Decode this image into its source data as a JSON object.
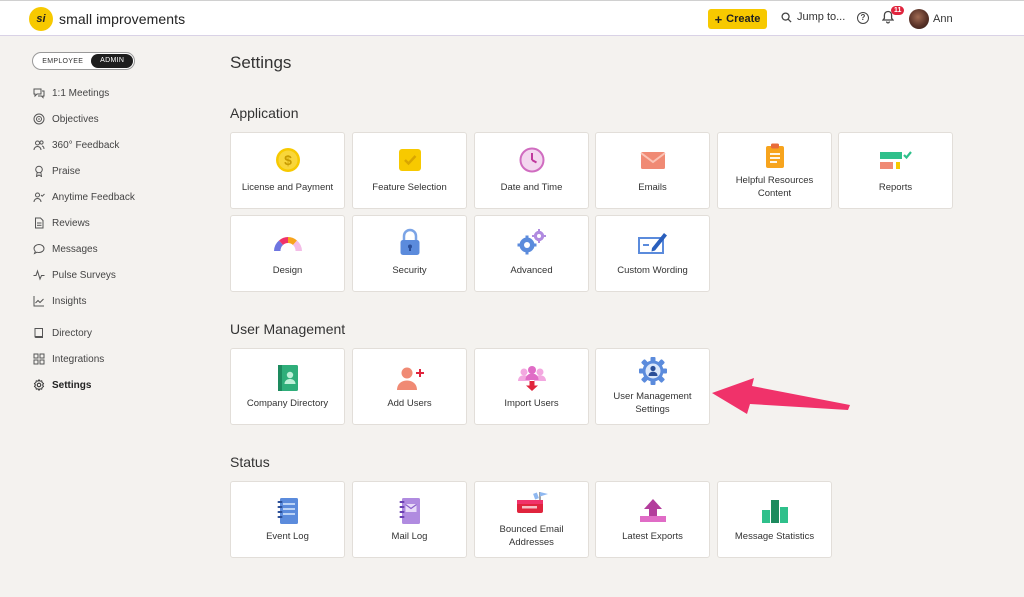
{
  "header": {
    "logo_mark": "si",
    "logo_text": "small improvements",
    "create_label": "Create",
    "jump_label": "Jump to...",
    "notification_count": "11",
    "user_name": "Ann"
  },
  "sidebar": {
    "role_employee": "EMPLOYEE",
    "role_admin": "ADMIN",
    "items": [
      {
        "label": "1:1 Meetings",
        "icon": "chat-bubbles-icon"
      },
      {
        "label": "Objectives",
        "icon": "target-icon"
      },
      {
        "label": "360° Feedback",
        "icon": "people-icon"
      },
      {
        "label": "Praise",
        "icon": "award-icon"
      },
      {
        "label": "Anytime Feedback",
        "icon": "person-check-icon"
      },
      {
        "label": "Reviews",
        "icon": "document-icon"
      },
      {
        "label": "Messages",
        "icon": "speech-bubble-icon"
      },
      {
        "label": "Pulse Surveys",
        "icon": "pulse-icon"
      },
      {
        "label": "Insights",
        "icon": "chart-icon"
      },
      {
        "label": "Directory",
        "icon": "book-icon"
      },
      {
        "label": "Integrations",
        "icon": "grid-icon"
      },
      {
        "label": "Settings",
        "icon": "gear-icon",
        "active": true
      }
    ]
  },
  "main": {
    "title": "Settings",
    "sections": {
      "application": {
        "title": "Application",
        "tiles": [
          {
            "label": "License and Payment",
            "icon": "dollar-coin-icon"
          },
          {
            "label": "Feature Selection",
            "icon": "checkbox-icon"
          },
          {
            "label": "Date and Time",
            "icon": "clock-icon"
          },
          {
            "label": "Emails",
            "icon": "envelope-icon"
          },
          {
            "label": "Helpful Resources Content",
            "icon": "clipboard-icon"
          },
          {
            "label": "Reports",
            "icon": "report-icon"
          },
          {
            "label": "Design",
            "icon": "color-arc-icon"
          },
          {
            "label": "Security",
            "icon": "lock-icon"
          },
          {
            "label": "Advanced",
            "icon": "gears-icon"
          },
          {
            "label": "Custom Wording",
            "icon": "edit-card-icon"
          }
        ]
      },
      "user_management": {
        "title": "User Management",
        "tiles": [
          {
            "label": "Company Directory",
            "icon": "address-book-icon"
          },
          {
            "label": "Add Users",
            "icon": "add-user-icon"
          },
          {
            "label": "Import Users",
            "icon": "import-users-icon"
          },
          {
            "label": "User Management Settings",
            "icon": "user-gear-icon"
          }
        ]
      },
      "status": {
        "title": "Status",
        "tiles": [
          {
            "label": "Event Log",
            "icon": "notebook-icon"
          },
          {
            "label": "Mail Log",
            "icon": "mail-notebook-icon"
          },
          {
            "label": "Bounced Email Addresses",
            "icon": "mailbox-icon"
          },
          {
            "label": "Latest Exports",
            "icon": "upload-icon"
          },
          {
            "label": "Message Statistics",
            "icon": "bar-stats-icon"
          }
        ]
      }
    }
  },
  "colors": {
    "accent_yellow": "#f7c900",
    "admin_toggle": "#1e1e1e",
    "badge_red": "#e0243d",
    "annotation_arrow": "#f0326a"
  }
}
